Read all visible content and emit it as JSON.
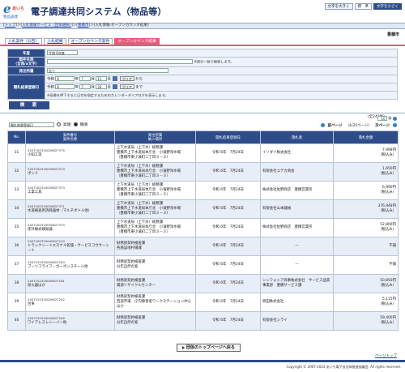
{
  "header": {
    "logo_e": "e",
    "logo_ai": "あいち",
    "logo_sub": "物品調達",
    "title": "電子調達共同システム（物品等）",
    "font_larger": "文字を大きく",
    "font_standard": "標　準",
    "font_smaller": "文字を小さく"
  },
  "breadcrumb": {
    "items": [
      "トップ",
      "入札情報サービス（団体選択）",
      "豊橋市",
      "入札情報-オープンカウンタ結果"
    ]
  },
  "tabs": [
    "入札案件（公告）",
    "入札結果",
    "オープンカウンタ案件",
    "オープンカウンタ結果"
  ],
  "org_name": "豊橋市",
  "form": {
    "fiscal_year_label": "年度",
    "fiscal_year_value": "令和 6年度",
    "case_name_label": "案件名称\n（全角/a文字）",
    "case_name_note": "※部分一致で検索します。",
    "dept_label": "発注所属",
    "dept_value": "全て",
    "date_label": "開札結果登録日",
    "date_era": "令和",
    "year_suffix": "年",
    "month_suffix": "月",
    "day_suffix": "日",
    "from_year": "6",
    "from_month": "7",
    "from_day": "11",
    "to_year": "6",
    "to_month": "7",
    "to_day": "24",
    "clear_label": "クリア",
    "from_suffix": "から",
    "to_suffix": "まで",
    "calendar_note": "※画像を押下すると日付を指定するためのカレンダーダイアログを表示します。",
    "search_button": "検　索"
  },
  "count_text": "（全240件）",
  "sort": {
    "field": "開札結果登録日",
    "asc_label": "昇順",
    "desc_label": "降順"
  },
  "pager": {
    "per_page": "10",
    "per_page_suffix": "件",
    "prev": "前ページ",
    "info": "（4/25ページ）",
    "next": "次ページ"
  },
  "table": {
    "headers": {
      "no": "No.",
      "case": "案件番号\n案件名称",
      "dept": "発注所属\n納入場所",
      "date": "開札結果登録日",
      "winner": "落札者",
      "amount": "落札金額"
    },
    "rows": [
      {
        "no": "31",
        "num": "2407162320000627375",
        "name": "小知工等",
        "dept1": "上下水道局（上下水）総務課",
        "dept2": "豊橋市上下水道局本庁舎　小濱野浄水場",
        "dept3": "（豊橋市東小濱町二丁目３－３）",
        "date": "令和 6年　7月24日",
        "winner": "イソダイ株式会社",
        "amount": "7,998円",
        "amount_note": "（税込み）"
      },
      {
        "no": "32",
        "num": "2407162320000627374",
        "name": "ポンド",
        "dept1": "上下水道局（上下水）総務課",
        "dept2": "豊橋市上下水道局本庁舎　小濱野浄水場",
        "dept3": "（豊橋市東小濱町二丁目３－３）",
        "date": "令和 6年　7月24日",
        "winner": "有限会社ユテカ商会",
        "amount": "1,650円",
        "amount_note": "（税込み）"
      },
      {
        "no": "33",
        "num": "2407162320000627373",
        "name": "工業工具",
        "dept1": "上下水道局（上下水）総務課",
        "dept2": "豊橋市上下水道局本庁舎　小濱野浄水場",
        "dept3": "（豊橋市東小濱町二丁目３－３）",
        "date": "令和 6年　7月24日",
        "winner": "株式会社佐野商店　豊橋営業所",
        "amount": "6,990円",
        "amount_note": "（税込み）"
      },
      {
        "no": "34",
        "num": "2407162320000627371",
        "name": "水道検査用消耗器材（マルチボトル他）",
        "dept1": "上下水道局（上下水）総務課",
        "dept2": "豊橋市上下水道局本庁舎　小濱野浄水場",
        "dept3": "（豊橋市東小濱町二丁目３－３）",
        "date": "令和 6年　7月24日",
        "winner": "有限会社山本器械",
        "amount": "376,948円",
        "amount_note": "（税込み）"
      },
      {
        "no": "35",
        "num": "2407162320000627370",
        "name": "赤外線式検知器",
        "dept1": "上下水道局（上下水）総務課",
        "dept2": "豊橋市上下水道局本庁舎　小濱野浄水場",
        "dept3": "（豊橋市東小濱町二丁目３－３）",
        "date": "令和 6年　7月24日",
        "winner": "株式会社佐野商店　豊橋営業所",
        "amount": "52,800円",
        "amount_note": "（税込み）"
      },
      {
        "no": "36",
        "num": "2407162320000627210",
        "name": "トラックシートエスナル乾燥・サービスコウサーシート",
        "dept1": "財務部契約検査課",
        "dept2": "各施設地村場課",
        "dept3": "",
        "date": "令和 6年　7月24日",
        "winner": "—",
        "amount": "不調",
        "amount_note": ""
      },
      {
        "no": "37",
        "num": "2407152320000627163",
        "name": "ブーツコライフ・ガーボンスチール他",
        "dept1": "財務部契約検査課",
        "dept2": "分年自然の家",
        "dept3": "",
        "date": "令和 6年　7月24日",
        "winner": "—",
        "amount": "不調",
        "amount_note": ""
      },
      {
        "no": "38",
        "num": "2407152320000627181",
        "name": "除火器ほか",
        "dept1": "財務部契約検査課",
        "dept2": "資源リサイクルセンター",
        "dept3": "",
        "date": "令和 6年　7月24日",
        "winner": "シンフォニア商事株式会社　サービス品質事業部　豊橋サービス課",
        "amount": "50,850円",
        "amount_note": "（税込み）"
      },
      {
        "no": "39",
        "num": "2407152320000627202",
        "name": "台車",
        "dept1": "財務部契約検査課",
        "dept2": "西部市場　庁内障害者ワークステーション中心ほか",
        "dept3": "",
        "date": "令和 6年　7月24日",
        "winner": "原田株式会社",
        "amount": "5,115円",
        "amount_note": "（税込み）"
      },
      {
        "no": "40",
        "num": "2407152320000627169",
        "name": "ワイアレスレシーバー他",
        "dept1": "財務部契約検査課",
        "dept2": "分年自然の家",
        "dept3": "",
        "date": "令和 6年　7月24日",
        "winner": "有限会社シライ",
        "amount": "59,400円",
        "amount_note": "（税込み）"
      }
    ]
  },
  "back_button": "団体のトップページへ戻る",
  "page_top": "ページトップ",
  "copyright": "Copyright © 2007-2024 あいち電子自治体推進協議会, All rights reserved."
}
